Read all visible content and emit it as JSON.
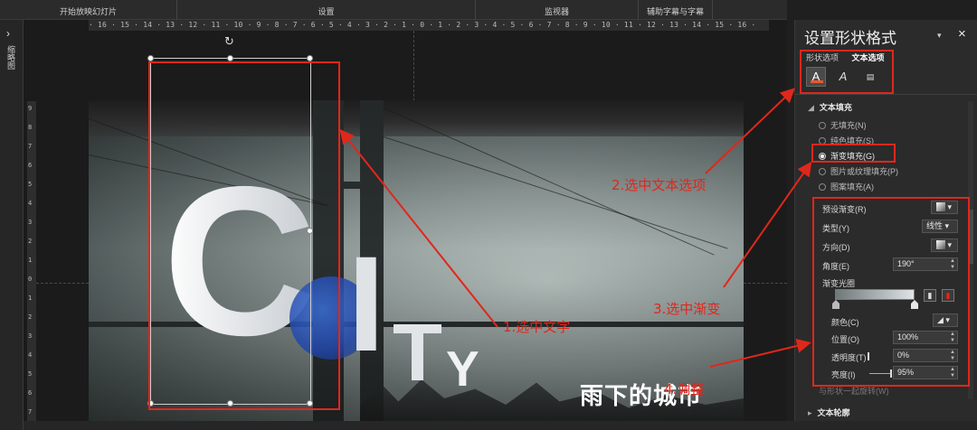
{
  "ribbon": {
    "groups": [
      "开始放映幻灯片",
      "设置",
      "监视器",
      "辅助字幕与字幕"
    ]
  },
  "left_strip": {
    "label": "缩略图"
  },
  "ruler": {
    "horizontal": "· 16 · 15 · 14 · 13 · 12 · 11 · 10 · 9 · 8 · 7 · 6 · 5 · 4 · 3 · 2 · 1 · 0 · 1 · 2 · 3 · 4 · 5 · 6 · 7 · 8 · 9 · 10 · 11 · 12 · 13 · 14 · 15 · 16 ·",
    "vertical": [
      "9",
      "8",
      "7",
      "6",
      "5",
      "4",
      "3",
      "2",
      "1",
      "0",
      "1",
      "2",
      "3",
      "4",
      "5",
      "6",
      "7"
    ]
  },
  "slide": {
    "letter_c": "C",
    "letter_i": "I",
    "letter_t": "T",
    "letter_y": "Y",
    "chinese_title": "雨下的城市"
  },
  "panel": {
    "title": "设置形状格式",
    "pin": "▾",
    "close": "×",
    "tabs": {
      "shape": "形状选项",
      "text": "文本选项"
    },
    "icons": [
      "text-fill-outline-icon",
      "text-effects-icon",
      "textbox-icon"
    ],
    "text_fill_section": "文本填充",
    "fill_options": [
      "无填充(N)",
      "纯色填充(S)",
      "渐变填充(G)",
      "图片或纹理填充(P)",
      "图案填充(A)"
    ],
    "selected_fill": "渐变填充(G)",
    "preset_label": "预设渐变(R)",
    "type_label": "类型(Y)",
    "type_value": "线性",
    "direction_label": "方向(D)",
    "angle_label": "角度(E)",
    "angle_value": "190°",
    "stops_label": "渐变光圈",
    "color_label": "颜色(C)",
    "position_label": "位置(O)",
    "position_value": "100%",
    "transparency_label": "透明度(T)",
    "transparency_value": "0%",
    "brightness_label": "亮度(I)",
    "brightness_value": "95%",
    "rotate_label": "与形状一起旋转(W)",
    "outline_section": "文本轮廓"
  },
  "annotations": {
    "step1": "1.选中文字",
    "step2": "2.选中文本选项",
    "step3": "3.选中渐变",
    "step4": "4.调整",
    "color": "#e0271c"
  }
}
